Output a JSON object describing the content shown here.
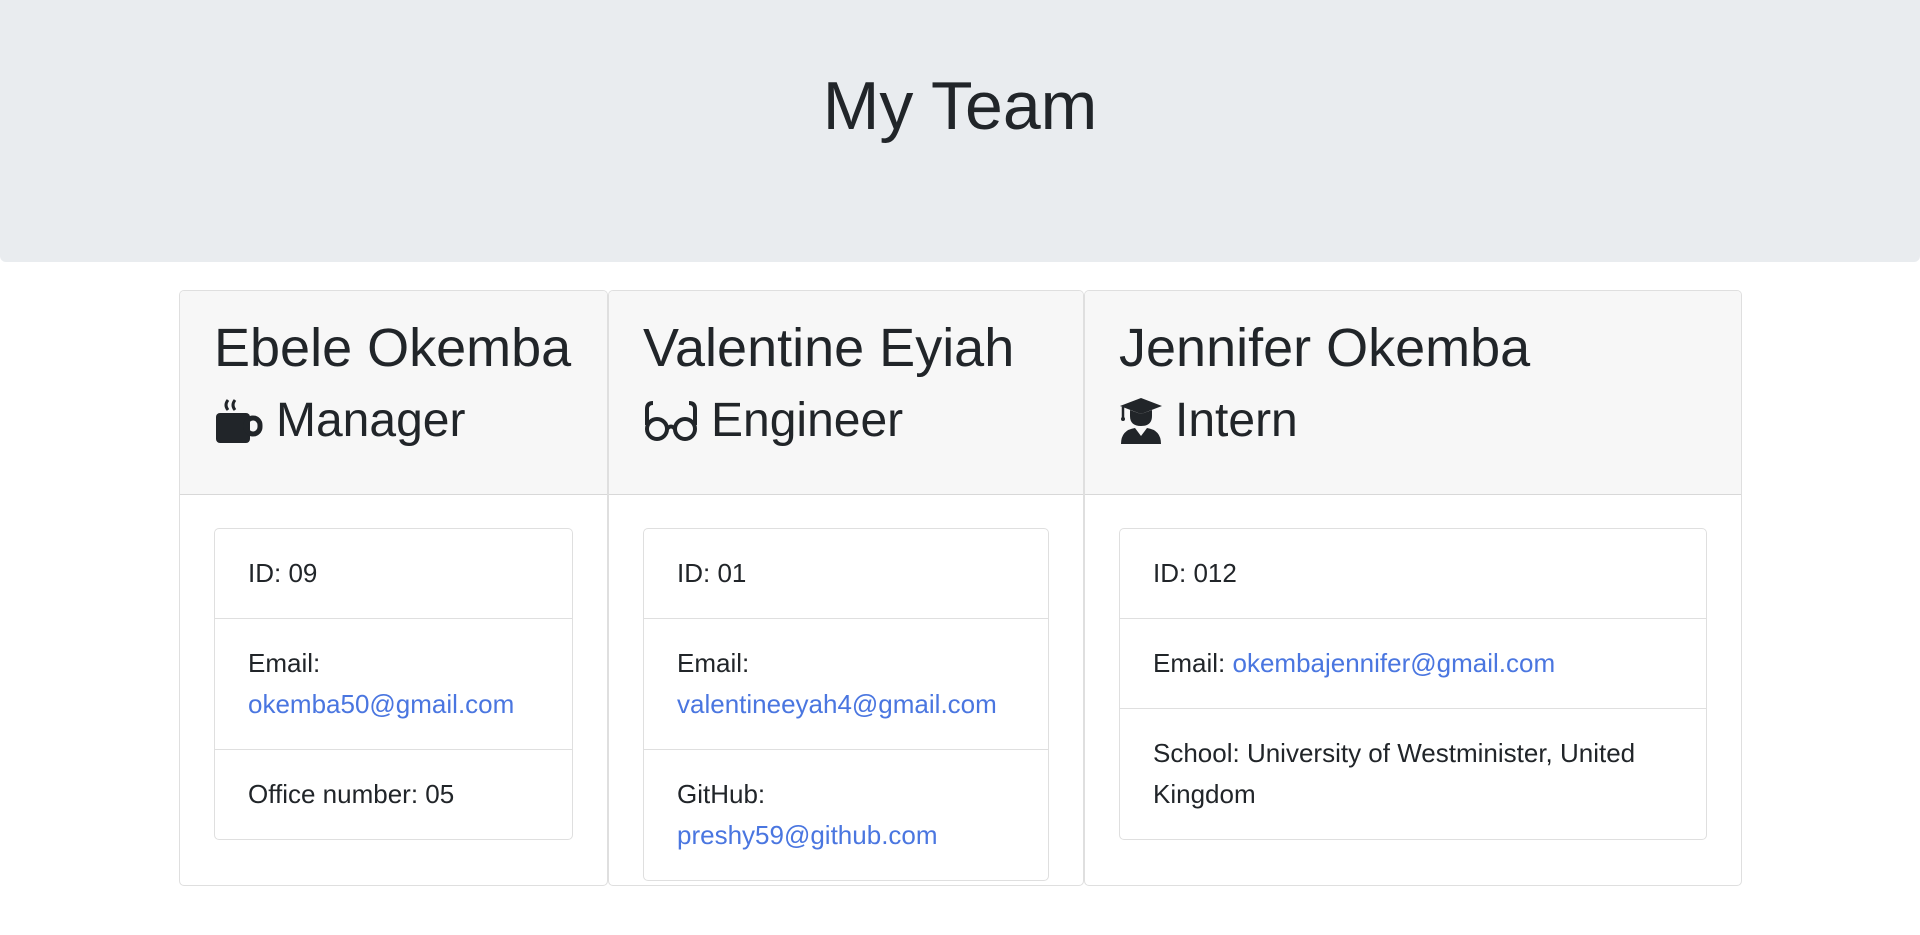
{
  "header": {
    "title": "My Team"
  },
  "colors": {
    "link": "#4a76e0",
    "jumbotron_bg": "#e9ecef",
    "card_header_bg": "#f7f7f7"
  },
  "team": [
    {
      "name": "Ebele Okemba",
      "role": "Manager",
      "role_icon": "coffee-mug-icon",
      "id_label": "ID: 09",
      "email_label": "Email:",
      "email": "okemba50@gmail.com",
      "extra_label": "Office number: 05"
    },
    {
      "name": "Valentine Eyiah",
      "role": "Engineer",
      "role_icon": "glasses-icon",
      "id_label": "ID: 01",
      "email_label": "Email:",
      "email": "valentineeyah4@gmail.com",
      "extra_label": "GitHub:",
      "github": "preshy59@github.com"
    },
    {
      "name": "Jennifer Okemba",
      "role": "Intern",
      "role_icon": "graduate-icon",
      "id_label": "ID: 012",
      "email_label": "Email:",
      "email": "okembajennifer@gmail.com",
      "extra_label": "School: University of Westminister, United Kingdom"
    }
  ]
}
